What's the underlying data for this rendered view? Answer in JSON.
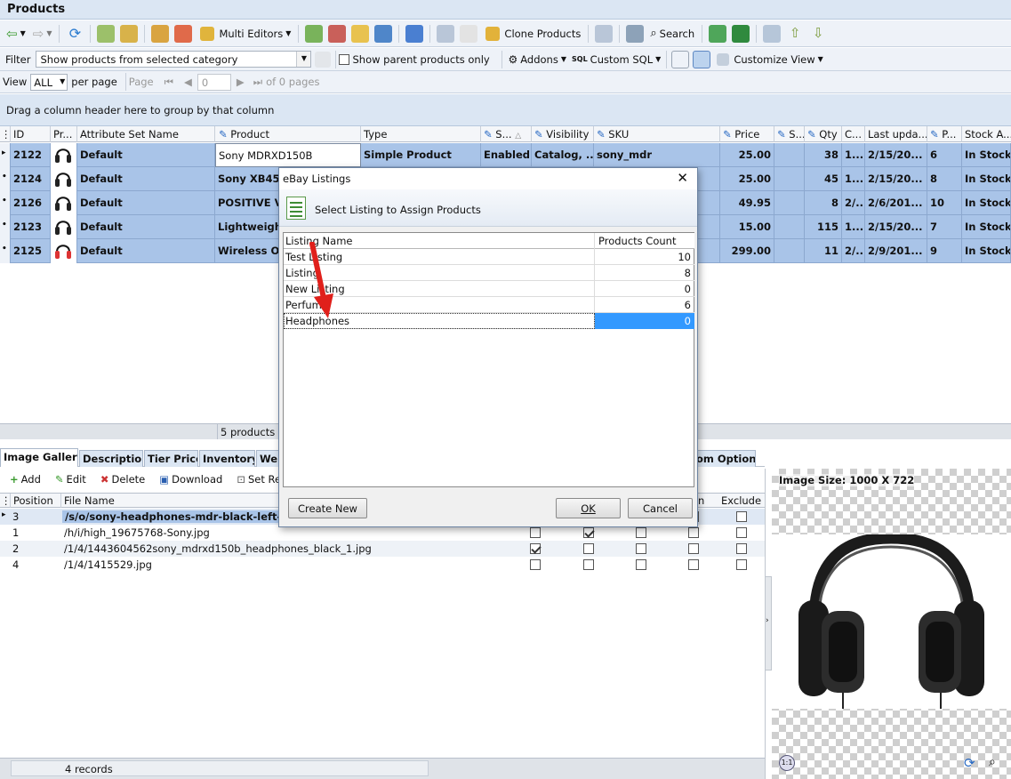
{
  "window": {
    "title": "Products"
  },
  "toolbar": {
    "multi_editors": "Multi Editors",
    "clone_products": "Clone Products",
    "search": "Search"
  },
  "filter": {
    "label": "Filter",
    "value": "Show products from selected category",
    "show_parent_label": "Show parent products only",
    "addons": "Addons",
    "custom_sql": "Custom SQL",
    "customize_view": "Customize View"
  },
  "view": {
    "label": "View",
    "value": "ALL",
    "per_page": "per page",
    "page_label": "Page",
    "page_value": "0",
    "of_pages": "of 0 pages"
  },
  "group_hint": "Drag a column header here to group by that column",
  "grid": {
    "columns": [
      "ID",
      "Pr...",
      "Attribute Set Name",
      "Product",
      "Type",
      "S...",
      "Visibility",
      "SKU",
      "Price",
      "S...",
      "Qty",
      "C...",
      "Last upda...",
      "P...",
      "Stock A..."
    ],
    "rows": [
      {
        "id": "2122",
        "attr": "Default",
        "product": "Sony MDRXD150B",
        "type": "Simple Product",
        "status": "Enabled",
        "visibility": "Catalog, ...",
        "sku": "sony_mdr",
        "price": "25.00",
        "qty": "38",
        "c": "1...",
        "updated": "2/15/20...",
        "p": "6",
        "stock": "In Stock"
      },
      {
        "id": "2124",
        "attr": "Default",
        "product": "Sony XB450",
        "type": "",
        "status": "",
        "visibility": "",
        "sku": "",
        "price": "25.00",
        "qty": "45",
        "c": "1...",
        "updated": "2/15/20...",
        "p": "8",
        "stock": "In Stock"
      },
      {
        "id": "2126",
        "attr": "Default",
        "product": "POSITIVE VI",
        "type": "",
        "status": "",
        "visibility": "",
        "sku": "",
        "price": "49.95",
        "qty": "8",
        "c": "2/...",
        "updated": "2/6/201...",
        "p": "10",
        "stock": "In Stock"
      },
      {
        "id": "2123",
        "attr": "Default",
        "product": "Lightweight",
        "type": "",
        "status": "",
        "visibility": "",
        "sku": "",
        "price": "15.00",
        "qty": "115",
        "c": "1...",
        "updated": "2/15/20...",
        "p": "7",
        "stock": "In Stock"
      },
      {
        "id": "2125",
        "attr": "Default",
        "product": "Wireless On-",
        "type": "",
        "status": "",
        "visibility": "",
        "sku": "",
        "price": "299.00",
        "qty": "11",
        "c": "2/...",
        "updated": "2/9/201...",
        "p": "9",
        "stock": "In Stock"
      }
    ],
    "footer_count": "5 products"
  },
  "bottom_tabs": [
    "Image Gallery",
    "Description",
    "Tier Price",
    "Inventory",
    "We",
    "om Options"
  ],
  "gallery": {
    "add": "Add",
    "edit": "Edit",
    "delete": "Delete",
    "download": "Download",
    "set_resize": "Set Resi",
    "col_position": "Position",
    "col_file": "File Name",
    "col_n": "n",
    "col_exclude": "Exclude",
    "rows": [
      {
        "pos": "3",
        "file": "/s/o/sony-headphones-mdr-black-left-100",
        "c1": false,
        "c2": false,
        "c3": false,
        "c4": false,
        "ex": false
      },
      {
        "pos": "1",
        "file": "/h/i/high_19675768-Sony.jpg",
        "c1": false,
        "c2": true,
        "c3": false,
        "c4": false,
        "ex": false
      },
      {
        "pos": "2",
        "file": "/1/4/1443604562sony_mdrxd150b_headphones_black_1.jpg",
        "c1": true,
        "c2": false,
        "c3": false,
        "c4": false,
        "ex": false
      },
      {
        "pos": "4",
        "file": "/1/4/1415529.jpg",
        "c1": false,
        "c2": false,
        "c3": false,
        "c4": false,
        "ex": false
      }
    ],
    "records": "4 records"
  },
  "image_preview": {
    "size_label": "Image Size: 1000 X 722"
  },
  "dialog": {
    "title": "eBay Listings",
    "subtitle": "Select Listing to Assign Products",
    "col_name": "Listing Name",
    "col_count": "Products Count",
    "rows": [
      {
        "name": "Test Listing",
        "count": "10"
      },
      {
        "name": "Listing",
        "count": "8"
      },
      {
        "name": "New Listing",
        "count": "0"
      },
      {
        "name": "Perfume",
        "count": "6"
      },
      {
        "name": "Headphones",
        "count": "0"
      }
    ],
    "create_new": "Create New",
    "ok": "OK",
    "cancel": "Cancel"
  },
  "colors": {
    "selection": "#a9c4e8",
    "highlight": "#3399ff",
    "header_bg": "#dbe6f3",
    "arrow": "#e0201b"
  }
}
